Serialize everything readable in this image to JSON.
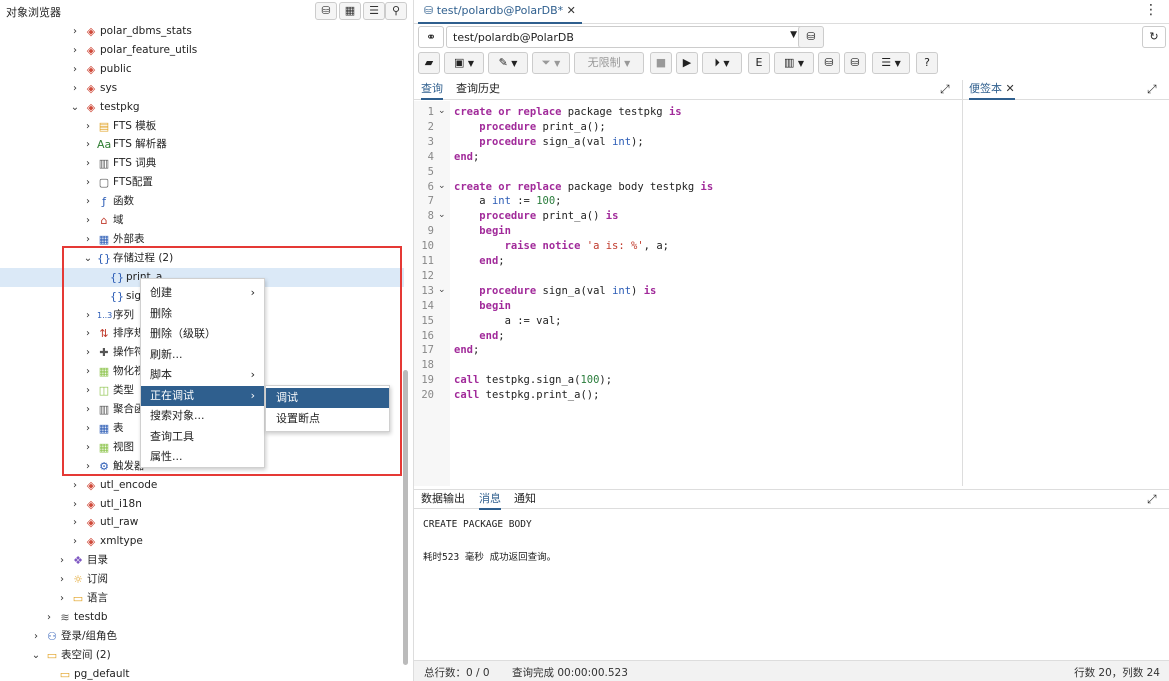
{
  "left_panel": {
    "title": "对象浏览器",
    "header_icons": [
      "database-icon",
      "table-icon",
      "filter-tree-icon",
      "search-icon"
    ],
    "tree": [
      {
        "label": "polar_dbms_stats",
        "arrow": "›",
        "icon": "◈",
        "icon_color": "#d04a3a"
      },
      {
        "label": "polar_feature_utils",
        "arrow": "›",
        "icon": "◈",
        "icon_color": "#d04a3a"
      },
      {
        "label": "public",
        "arrow": "›",
        "icon": "◈",
        "icon_color": "#d04a3a"
      },
      {
        "label": "sys",
        "arrow": "›",
        "icon": "◈",
        "icon_color": "#d04a3a"
      },
      {
        "label": "testpkg",
        "arrow": "⌄",
        "icon": "◈",
        "icon_color": "#d04a3a"
      },
      {
        "label": "FTS 模板",
        "arrow": "›",
        "icon": "▤",
        "icon_color": "#e0a020"
      },
      {
        "label": "FTS 解析器",
        "arrow": "›",
        "icon": "Aa",
        "icon_color": "#2f7d32"
      },
      {
        "label": "FTS 词典",
        "arrow": "›",
        "icon": "▥",
        "icon_color": "#555"
      },
      {
        "label": "FTS配置",
        "arrow": "›",
        "icon": "▢",
        "icon_color": "#555"
      },
      {
        "label": "函数",
        "arrow": "›",
        "icon": "ƒ",
        "icon_color": "#2a5bb5"
      },
      {
        "label": "域",
        "arrow": "›",
        "icon": "⌂",
        "icon_color": "#c0392b"
      },
      {
        "label": "外部表",
        "arrow": "›",
        "icon": "▦",
        "icon_color": "#2a5bb5"
      },
      {
        "label": "存储过程 (2)",
        "arrow": "⌄",
        "icon": "{}",
        "icon_color": "#2a5bb5"
      },
      {
        "label": "print_a",
        "arrow": "",
        "icon": "{}",
        "icon_color": "#2a5bb5"
      },
      {
        "label": "sign",
        "arrow": "",
        "icon": "{}",
        "icon_color": "#2a5bb5"
      },
      {
        "label": "序列",
        "arrow": "›",
        "icon": "1..3",
        "icon_color": "#2a5bb5"
      },
      {
        "label": "排序规",
        "arrow": "›",
        "icon": "⇅",
        "icon_color": "#c0392b"
      },
      {
        "label": "操作符",
        "arrow": "›",
        "icon": "✚",
        "icon_color": "#555"
      },
      {
        "label": "物化视",
        "arrow": "›",
        "icon": "▦",
        "icon_color": "#8bc34a"
      },
      {
        "label": "类型",
        "arrow": "›",
        "icon": "◫",
        "icon_color": "#8bc34a"
      },
      {
        "label": "聚合函",
        "arrow": "›",
        "icon": "▥",
        "icon_color": "#555"
      },
      {
        "label": "表",
        "arrow": "›",
        "icon": "▦",
        "icon_color": "#2a5bb5"
      },
      {
        "label": "视图",
        "arrow": "›",
        "icon": "▦",
        "icon_color": "#8bc34a"
      },
      {
        "label": "触发器",
        "arrow": "›",
        "icon": "⚙",
        "icon_color": "#2a5bb5"
      },
      {
        "label": "utl_encode",
        "arrow": "›",
        "icon": "◈",
        "icon_color": "#d04a3a"
      },
      {
        "label": "utl_i18n",
        "arrow": "›",
        "icon": "◈",
        "icon_color": "#d04a3a"
      },
      {
        "label": "utl_raw",
        "arrow": "›",
        "icon": "◈",
        "icon_color": "#d04a3a"
      },
      {
        "label": "xmltype",
        "arrow": "›",
        "icon": "◈",
        "icon_color": "#d04a3a"
      },
      {
        "label": "目录",
        "arrow": "›",
        "icon": "❖",
        "icon_color": "#7e57c2"
      },
      {
        "label": "订阅",
        "arrow": "›",
        "icon": "☼",
        "icon_color": "#e0a020"
      },
      {
        "label": "语言",
        "arrow": "›",
        "icon": "▭",
        "icon_color": "#e0a020"
      },
      {
        "label": "testdb",
        "arrow": "›",
        "icon": "≋",
        "icon_color": "#555"
      },
      {
        "label": "登录/组角色",
        "arrow": "›",
        "icon": "⚇",
        "icon_color": "#2a5bb5"
      },
      {
        "label": "表空间 (2)",
        "arrow": "⌄",
        "icon": "▭",
        "icon_color": "#e0a020"
      },
      {
        "label": "pg_default",
        "arrow": "",
        "icon": "▭",
        "icon_color": "#e0a020"
      }
    ]
  },
  "context_menu": {
    "items": [
      {
        "label": "创建",
        "submenu": true
      },
      {
        "label": "删除",
        "submenu": false
      },
      {
        "label": "删除（级联）",
        "submenu": false
      },
      {
        "label": "刷新...",
        "submenu": false
      },
      {
        "label": "脚本",
        "submenu": true
      },
      {
        "label": "正在调试",
        "submenu": true
      },
      {
        "label": "搜索对象...",
        "submenu": false
      },
      {
        "label": "查询工具",
        "submenu": false
      },
      {
        "label": "属性...",
        "submenu": false
      }
    ],
    "submenu_items": [
      "调试",
      "设置断点"
    ]
  },
  "editor_tab": {
    "title": "test/polardb@PolarDB*",
    "close": "✕"
  },
  "connection": {
    "value": "test/polardb@PolarDB"
  },
  "toolbar": {
    "limit_label": "无限制"
  },
  "query_tabs": [
    "查询",
    "查询历史"
  ],
  "scratch_tab": {
    "label": "便签本",
    "close": "✕"
  },
  "code_lines": [
    [
      {
        "t": "create or replace",
        "c": "kw"
      },
      {
        "t": " package testpkg ",
        "c": ""
      },
      {
        "t": "is",
        "c": "kw"
      }
    ],
    [
      {
        "t": "    ",
        "c": ""
      },
      {
        "t": "procedure",
        "c": "kw"
      },
      {
        "t": " print_a();",
        "c": ""
      }
    ],
    [
      {
        "t": "    ",
        "c": ""
      },
      {
        "t": "procedure",
        "c": "kw"
      },
      {
        "t": " sign_a(val ",
        "c": ""
      },
      {
        "t": "int",
        "c": "ty"
      },
      {
        "t": ");",
        "c": ""
      }
    ],
    [
      {
        "t": "end",
        "c": "kw"
      },
      {
        "t": ";",
        "c": ""
      }
    ],
    [],
    [
      {
        "t": "create or replace",
        "c": "kw"
      },
      {
        "t": " package body testpkg ",
        "c": ""
      },
      {
        "t": "is",
        "c": "kw"
      }
    ],
    [
      {
        "t": "    a ",
        "c": ""
      },
      {
        "t": "int",
        "c": "ty"
      },
      {
        "t": " := ",
        "c": ""
      },
      {
        "t": "100",
        "c": "num"
      },
      {
        "t": ";",
        "c": ""
      }
    ],
    [
      {
        "t": "    ",
        "c": ""
      },
      {
        "t": "procedure",
        "c": "kw"
      },
      {
        "t": " print_a() ",
        "c": ""
      },
      {
        "t": "is",
        "c": "kw"
      }
    ],
    [
      {
        "t": "    ",
        "c": ""
      },
      {
        "t": "begin",
        "c": "kw"
      }
    ],
    [
      {
        "t": "        ",
        "c": ""
      },
      {
        "t": "raise notice",
        "c": "kw"
      },
      {
        "t": " ",
        "c": ""
      },
      {
        "t": "'a is: %'",
        "c": "str"
      },
      {
        "t": ", a;",
        "c": ""
      }
    ],
    [
      {
        "t": "    ",
        "c": ""
      },
      {
        "t": "end",
        "c": "kw"
      },
      {
        "t": ";",
        "c": ""
      }
    ],
    [],
    [
      {
        "t": "    ",
        "c": ""
      },
      {
        "t": "procedure",
        "c": "kw"
      },
      {
        "t": " sign_a(val ",
        "c": ""
      },
      {
        "t": "int",
        "c": "ty"
      },
      {
        "t": ") ",
        "c": ""
      },
      {
        "t": "is",
        "c": "kw"
      }
    ],
    [
      {
        "t": "    ",
        "c": ""
      },
      {
        "t": "begin",
        "c": "kw"
      }
    ],
    [
      {
        "t": "        a := val;",
        "c": ""
      }
    ],
    [
      {
        "t": "    ",
        "c": ""
      },
      {
        "t": "end",
        "c": "kw"
      },
      {
        "t": ";",
        "c": ""
      }
    ],
    [
      {
        "t": "end",
        "c": "kw"
      },
      {
        "t": ";",
        "c": ""
      }
    ],
    [],
    [
      {
        "t": "call",
        "c": "kw"
      },
      {
        "t": " testpkg.sign_a(",
        "c": ""
      },
      {
        "t": "100",
        "c": "num"
      },
      {
        "t": ");",
        "c": ""
      }
    ],
    [
      {
        "t": "call",
        "c": "kw"
      },
      {
        "t": " testpkg.print_a();",
        "c": ""
      }
    ]
  ],
  "fold_lines": [
    1,
    6,
    8,
    13
  ],
  "output_tabs": [
    "数据输出",
    "消息",
    "通知"
  ],
  "output": {
    "line1": "CREATE PACKAGE BODY",
    "line2": "耗时523 毫秒 成功返回查询。"
  },
  "status": {
    "total_rows": "总行数：0 / 0",
    "query_done": "查询完成 00:00:00.523",
    "cursor": "行数 20，列数 24"
  }
}
